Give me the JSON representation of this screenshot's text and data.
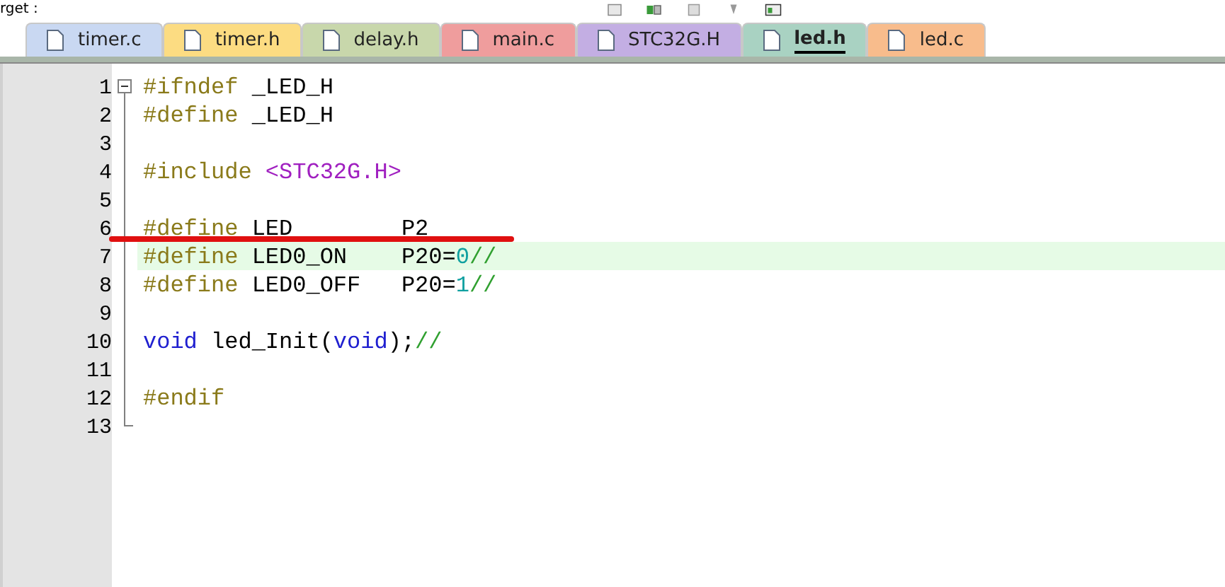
{
  "toolbar": {
    "label": "rget :"
  },
  "tabs": [
    {
      "label": "timer.c",
      "selected": false,
      "color": "#c9d8f2"
    },
    {
      "label": "timer.h",
      "selected": false,
      "color": "#fcdc82"
    },
    {
      "label": "delay.h",
      "selected": false,
      "color": "#c8d7ab"
    },
    {
      "label": "main.c",
      "selected": false,
      "color": "#ef9d9d"
    },
    {
      "label": "STC32G.H",
      "selected": false,
      "color": "#c3aee3"
    },
    {
      "label": "led.h",
      "selected": true,
      "color": "#a9d2c2"
    },
    {
      "label": "led.c",
      "selected": false,
      "color": "#f8bc8c"
    }
  ],
  "lines": [
    {
      "number": "1",
      "tokens": [
        {
          "kind": "directive",
          "text": "#ifndef"
        },
        {
          "kind": "plain",
          "text": " _LED_H"
        }
      ]
    },
    {
      "number": "2",
      "tokens": [
        {
          "kind": "directive",
          "text": "#define"
        },
        {
          "kind": "plain",
          "text": " _LED_H"
        }
      ]
    },
    {
      "number": "3"
    },
    {
      "number": "4",
      "tokens": [
        {
          "kind": "directive",
          "text": "#include"
        },
        {
          "kind": "string",
          "text": "<STC32G.H>",
          "space_before": true
        }
      ]
    },
    {
      "number": "5"
    },
    {
      "number": "6",
      "underlined": true,
      "tokens": [
        {
          "kind": "directive",
          "text": "#define"
        },
        {
          "kind": "plain",
          "text": " LED        P2"
        }
      ]
    },
    {
      "number": "7",
      "current": true,
      "tokens": [
        {
          "kind": "directive",
          "text": "#define"
        },
        {
          "kind": "plain",
          "text": " LED0_ON    P20="
        },
        {
          "kind": "number",
          "text": "0"
        },
        {
          "kind": "comment",
          "text": "//"
        }
      ]
    },
    {
      "number": "8",
      "tokens": [
        {
          "kind": "directive",
          "text": "#define"
        },
        {
          "kind": "plain",
          "text": " LED0_OFF   P20="
        },
        {
          "kind": "number",
          "text": "1"
        },
        {
          "kind": "comment",
          "text": "//"
        }
      ]
    },
    {
      "number": "9"
    },
    {
      "number": "10",
      "tokens": [
        {
          "kind": "keyword",
          "text": "void"
        },
        {
          "kind": "plain",
          "text": " led_Init("
        },
        {
          "kind": "keyword",
          "text": "void"
        },
        {
          "kind": "plain",
          "text": ");"
        },
        {
          "kind": "comment",
          "text": "//"
        }
      ]
    },
    {
      "number": "11"
    },
    {
      "number": "12",
      "tokens": [
        {
          "kind": "directive",
          "text": "#endif"
        }
      ]
    },
    {
      "number": "13"
    }
  ]
}
